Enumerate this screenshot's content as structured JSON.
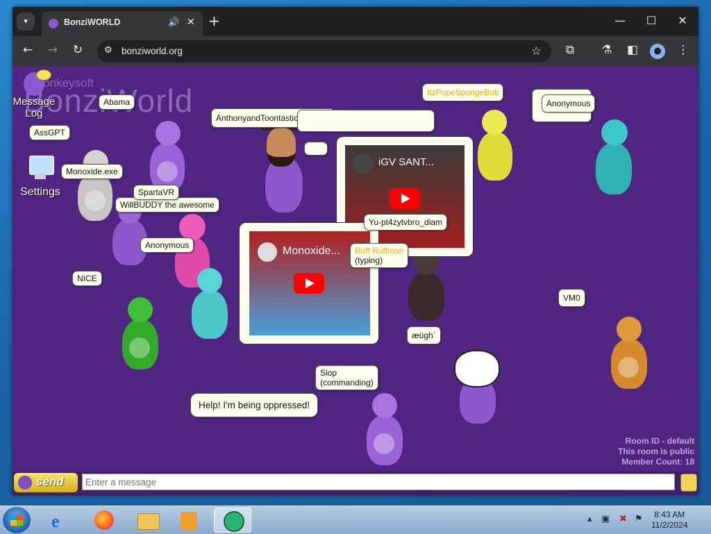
{
  "browser": {
    "tab": {
      "title": "BonziWORLD"
    },
    "url": "bonziworld.org",
    "icons": [
      "chevron-down-icon",
      "bonzi-favicon",
      "speaker-icon",
      "close-icon",
      "plus-icon",
      "minimize-icon",
      "maximize-icon",
      "close-window-icon",
      "back-icon",
      "forward-icon",
      "reload-icon",
      "site-info-icon",
      "star-icon",
      "extensions-icon",
      "labs-icon",
      "sidebar-icon",
      "profile-icon",
      "menu-icon"
    ]
  },
  "app": {
    "logo": {
      "small": "Monkeysoft",
      "big": "BonziWorld"
    },
    "sidebar": {
      "message_log": "Message Log",
      "settings": "Settings"
    },
    "bubbles": [
      {
        "id": "abama",
        "text": "Abama"
      },
      {
        "id": "assgpt",
        "text": "AssGPT"
      },
      {
        "id": "monoxide",
        "text": "Monoxide.exe"
      },
      {
        "id": "spartavr",
        "text": "SpartaVR"
      },
      {
        "id": "willbuddy",
        "text": "WillBUDDY the awesome"
      },
      {
        "id": "anonymous1",
        "text": "Anonymous"
      },
      {
        "id": "nice",
        "text": "NICE"
      },
      {
        "id": "anthony",
        "text": "AnthonyandToontasticFan2010"
      },
      {
        "id": "itzpope",
        "text": "ItzPopeSpongeBob"
      },
      {
        "id": "anonymous2",
        "text": "Anonymous"
      },
      {
        "id": "yupt",
        "text": "Yu-pt4zytvbro_diam"
      },
      {
        "id": "ruff",
        "text": "Ruff Ruffman",
        "sub": "(typing)"
      },
      {
        "id": "vm0",
        "text": "VM0"
      },
      {
        "id": "aeugh",
        "text": "æüghˊ"
      },
      {
        "id": "slop",
        "text": "Slop",
        "sub": "(commanding)"
      },
      {
        "id": "help",
        "text": "Help! I'm being oppressed!"
      }
    ],
    "videos": [
      {
        "id": "video1",
        "title": "iGV SANT..."
      },
      {
        "id": "video2",
        "title": "Monoxide..."
      }
    ],
    "room": {
      "id_line": "Room ID - default",
      "public_line": "This room is public",
      "count_line": "Member Count: 18"
    },
    "chat": {
      "send_label": "send",
      "placeholder": "Enter a message"
    }
  },
  "taskbar": {
    "apps": [
      "internet-explorer-icon",
      "firefox-icon",
      "file-explorer-icon",
      "media-player-icon",
      "chat-app-icon"
    ],
    "clock": {
      "time": "8:43 AM",
      "date": "11/2/2024"
    }
  },
  "colors": {
    "stage_bg": "#4f2581",
    "bubble_bg": "#fffff0",
    "yellow_name": "#f0a800",
    "send_yellow": "#f3d352"
  }
}
